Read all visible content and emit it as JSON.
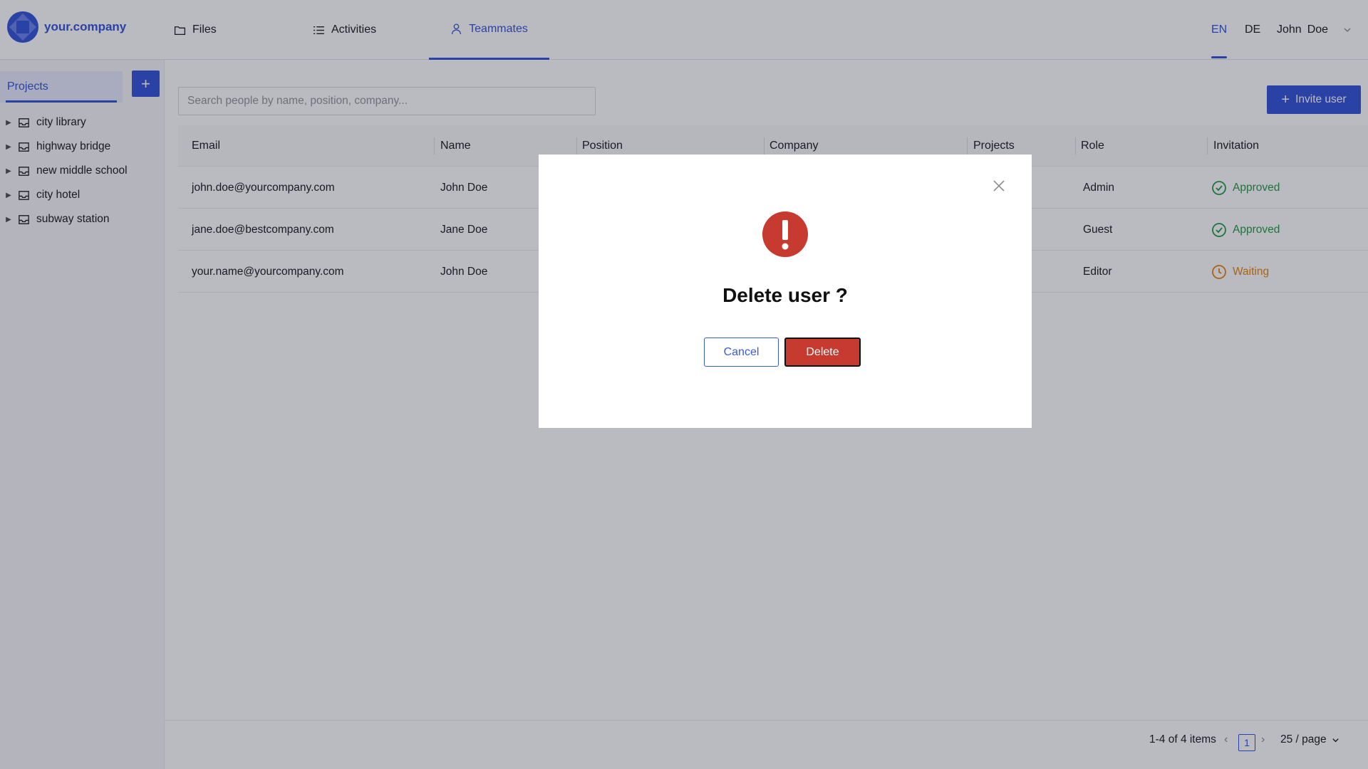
{
  "header": {
    "brand": "your.company",
    "tabs": [
      {
        "label": "Files",
        "icon": "folder-icon"
      },
      {
        "label": "Activities",
        "icon": "list-icon"
      },
      {
        "label": "Teammates",
        "icon": "person-icon"
      }
    ],
    "active_tab": "Teammates",
    "languages": [
      "EN",
      "DE"
    ],
    "active_language": "EN",
    "user": {
      "first_name": "John",
      "last_name": "Doe"
    }
  },
  "sidebar": {
    "tab_label": "Projects",
    "add_label": "+",
    "projects": [
      "city library",
      "highway bridge",
      "new middle school",
      "city hotel",
      "subway station"
    ]
  },
  "main": {
    "search_placeholder": "Search people by name, position, company...",
    "invite_label": "Invite user",
    "columns": [
      "Email",
      "Name",
      "Position",
      "Company",
      "Projects",
      "Role",
      "Invitation"
    ],
    "rows": [
      {
        "email": "john.doe@yourcompany.com",
        "name": "John Doe",
        "role": "Admin",
        "invitation": "Approved"
      },
      {
        "email": "jane.doe@bestcompany.com",
        "name": "Jane Doe",
        "role": "Guest",
        "invitation": "Approved"
      },
      {
        "email": "your.name@yourcompany.com",
        "name": "John Doe",
        "role": "Editor",
        "invitation": "Waiting"
      }
    ]
  },
  "pagination": {
    "summary": "1-4 of 4 items",
    "current_page": "1",
    "page_size": "25 / page"
  },
  "modal": {
    "title": "Delete user ?",
    "cancel_label": "Cancel",
    "delete_label": "Delete"
  },
  "colors": {
    "accent": "#3a5bd9",
    "danger": "#c73a2f",
    "approved": "#2e9e4a",
    "waiting": "#e58a12"
  }
}
